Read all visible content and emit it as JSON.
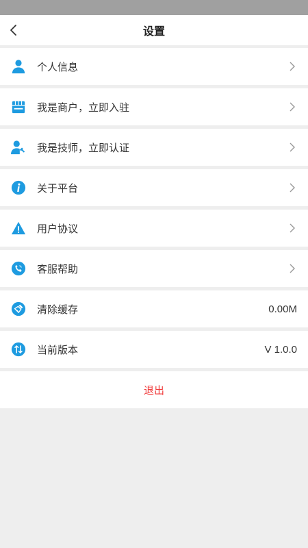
{
  "header": {
    "title": "设置",
    "back_icon": "chevron-left-icon"
  },
  "settings": {
    "items": [
      {
        "label": "个人信息",
        "icon": "user-icon",
        "has_chevron": true
      },
      {
        "label": "我是商户，立即入驻",
        "icon": "shop-icon",
        "has_chevron": true
      },
      {
        "label": "我是技师，立即认证",
        "icon": "technician-icon",
        "has_chevron": true
      },
      {
        "label": "关于平台",
        "icon": "info-icon",
        "has_chevron": true
      },
      {
        "label": "用户协议",
        "icon": "warning-icon",
        "has_chevron": true
      },
      {
        "label": "客服帮助",
        "icon": "phone-icon",
        "has_chevron": true
      },
      {
        "label": "清除缓存",
        "icon": "broom-icon",
        "has_chevron": false,
        "value": "0.00M"
      },
      {
        "label": "当前版本",
        "icon": "version-arrows-icon",
        "has_chevron": false,
        "value": "V 1.0.0"
      }
    ]
  },
  "logout": {
    "label": "退出"
  },
  "colors": {
    "status_bar": "#a0a0a0",
    "accent": "#1e9be0",
    "logout": "#f03a3a",
    "background": "#eeeeee",
    "text": "#333333",
    "chevron": "#999999"
  }
}
